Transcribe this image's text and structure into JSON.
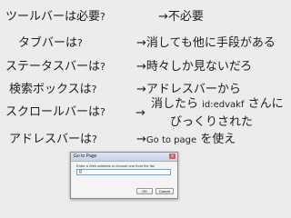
{
  "rows": [
    {
      "left": "ツールバーは必要",
      "left_q": "?",
      "right": "→不必要"
    },
    {
      "left": "タブバーは",
      "left_q": "?",
      "right": "→消しても他に手段がある"
    },
    {
      "left": "ステータスバーは",
      "left_q": "?",
      "right": "→時々しか見ないだろ"
    },
    {
      "left": "検索ボックスは",
      "left_q": "?",
      "right": "→アドレスバーから"
    },
    {
      "left": "スクロールバーは",
      "left_q": "?",
      "right_arrow": "→",
      "right_line1_a": "消したら ",
      "right_line1_b": "id:edvakf",
      "right_line1_c": " さんに",
      "right_line2": "びっくりされた"
    },
    {
      "left": "アドレスバーは",
      "left_q": "?",
      "right_a": "→",
      "right_b": "Go to page",
      "right_c": " を使え"
    }
  ],
  "dialog": {
    "title": "Go to Page",
    "close_glyph": "x",
    "message": "Enter a Web address or choose one from the list",
    "input_value": "g",
    "ok_label": "OK",
    "cancel_label": "Cancel"
  }
}
